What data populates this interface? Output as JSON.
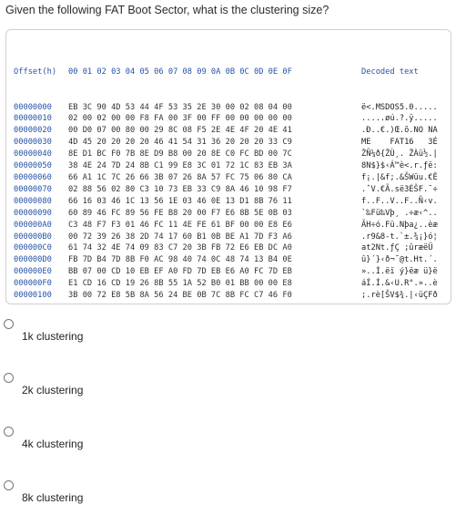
{
  "question": "Given the following FAT Boot Sector, what is the clustering size?",
  "header": {
    "offset_label": "Offset(h)",
    "columns": "00 01 02 03 04 05 06 07 08 09 0A 0B 0C 0D 0E 0F",
    "decoded_label": "Decoded text"
  },
  "rows": [
    {
      "off": "00000000",
      "bytes": "EB 3C 90 4D 53 44 4F 53 35 2E 30 00 02 08 04 00",
      "txt": "ë<.MSDOS5.0....."
    },
    {
      "off": "00000010",
      "bytes": "02 00 02 00 00 F8 FA 00 3F 00 FF 00 00 00 00 00",
      "txt": ".....øú.?.ÿ....."
    },
    {
      "off": "00000020",
      "bytes": "00 D0 07 00 80 00 29 8C 08 F5 2E 4E 4F 20 4E 41",
      "txt": ".Ð..€.)Œ.õ.NO NA"
    },
    {
      "off": "00000030",
      "bytes": "4D 45 20 20 20 20 46 41 54 31 36 20 20 20 33 C9",
      "txt": "ME    FAT16   3É"
    },
    {
      "off": "00000040",
      "bytes": "8E D1 BC F0 7B 8E D9 B8 00 20 8E C0 FC BD 00 7C",
      "txt": "ŽÑ¼ð{ŽÙ¸. ŽÀü½.|"
    },
    {
      "off": "00000050",
      "bytes": "38 4E 24 7D 24 8B C1 99 E8 3C 01 72 1C 83 EB 3A",
      "txt": "8N$}$‹Á™è<.r.ƒë:"
    },
    {
      "off": "00000060",
      "bytes": "66 A1 1C 7C 26 66 3B 07 26 8A 57 FC 75 06 80 CA",
      "txt": "f¡.|&f;.&ŠWüu.€Ê"
    },
    {
      "off": "00000070",
      "bytes": "02 88 56 02 80 C3 10 73 EB 33 C9 8A 46 10 98 F7",
      "txt": ".ˆV.€Ã.së3ÉŠF.˜÷"
    },
    {
      "off": "00000080",
      "bytes": "66 16 03 46 1C 13 56 1E 03 46 0E 13 D1 8B 76 11",
      "txt": "f..F..V..F..Ñ‹v."
    },
    {
      "off": "00000090",
      "bytes": "60 89 46 FC 89 56 FE B8 20 00 F7 E6 8B 5E 0B 03",
      "txt": "`‰Fü‰Vþ¸ .÷æ‹^.."
    },
    {
      "off": "000000A0",
      "bytes": "C3 48 F7 F3 01 46 FC 11 4E FE 61 BF 00 00 E8 E6",
      "txt": "ÃH÷ó.Fü.Nþa¿..èæ"
    },
    {
      "off": "000000B0",
      "bytes": "00 72 39 26 38 2D 74 17 60 B1 0B BE A1 7D F3 A6",
      "txt": ".r9&8-t.`±.¾¡}ó¦"
    },
    {
      "off": "000000C0",
      "bytes": "61 74 32 4E 74 09 83 C7 20 3B FB 72 E6 EB DC A0",
      "txt": "at2Nt.ƒÇ ;ûræëÜ "
    },
    {
      "off": "000000D0",
      "bytes": "FB 7D B4 7D 8B F0 AC 98 40 74 0C 48 74 13 B4 0E",
      "txt": "û}´}‹ð¬˜@t.Ht.´."
    },
    {
      "off": "000000E0",
      "bytes": "BB 07 00 CD 10 EB EF A0 FD 7D EB E6 A0 FC 7D EB",
      "txt": "»..Í.ëï ý}ëæ ü}ë"
    },
    {
      "off": "000000F0",
      "bytes": "E1 CD 16 CD 19 26 8B 55 1A 52 B0 01 BB 00 00 E8",
      "txt": "áÍ.Í.&‹U.R°.»..è"
    },
    {
      "off": "00000100",
      "bytes": "3B 00 72 E8 5B 8A 56 24 BE 0B 7C 8B FC C7 46 F0",
      "txt": ";.rè[ŠV$¾.|‹üÇFð"
    }
  ],
  "options": [
    {
      "label": "1k clustering"
    },
    {
      "label": "2k clustering"
    },
    {
      "label": "4k clustering"
    },
    {
      "label": "8k clustering"
    }
  ]
}
